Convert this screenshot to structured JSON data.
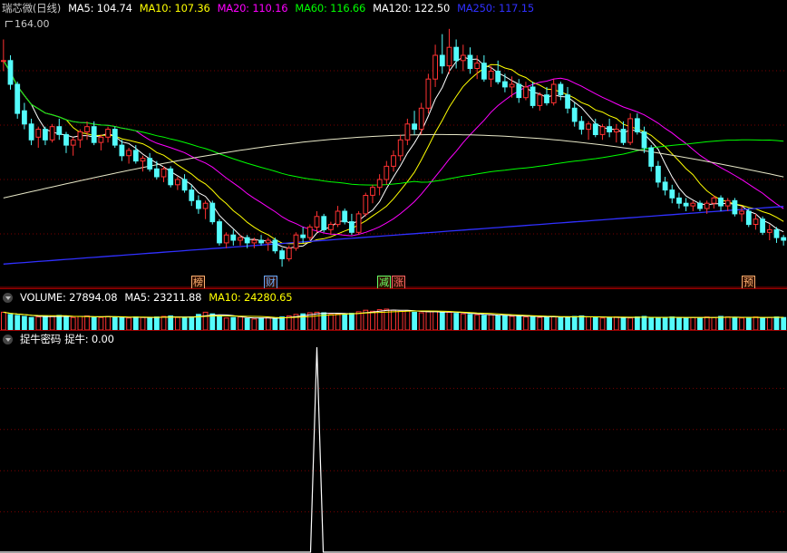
{
  "main": {
    "title": "瑞芯微(日线)",
    "ma_items": [
      {
        "label": "MA5: 104.74",
        "color": "#ffffff"
      },
      {
        "label": "MA10: 107.36",
        "color": "#ffff00"
      },
      {
        "label": "MA20: 110.16",
        "color": "#ff00ff"
      },
      {
        "label": "MA60: 116.66",
        "color": "#00ff00"
      },
      {
        "label": "MA120: 122.50",
        "color": "#ffffff"
      },
      {
        "label": "MA250: 117.15",
        "color": "#3030ff"
      }
    ],
    "high_label": "164.00"
  },
  "markers": [
    {
      "text": "榜",
      "color": "#ffb070"
    },
    {
      "text": "财",
      "color": "#66aaff"
    },
    {
      "text": "减",
      "color": "#66ff66"
    },
    {
      "text": "涨",
      "color": "#ff6666"
    },
    {
      "text": "预",
      "color": "#ffb070"
    }
  ],
  "volume": {
    "label": "VOLUME: 27894.08",
    "ma5": "MA5: 23211.88",
    "ma10": "MA10: 24280.65"
  },
  "indicator": {
    "name": "捉牛密码",
    "value_label": "捉牛: 0.00"
  },
  "colors": {
    "up": "#ff3232",
    "down": "#54fcfc",
    "grid": "#7a0000"
  },
  "chart_data": {
    "type": "candlestick",
    "price_high_label": 164.0,
    "candles": [
      [
        150,
        158,
        146,
        150
      ],
      [
        150,
        152,
        139,
        141
      ],
      [
        141,
        142,
        128,
        130
      ],
      [
        131,
        134,
        124,
        126
      ],
      [
        126,
        128,
        118,
        120
      ],
      [
        121,
        125,
        117,
        124
      ],
      [
        124,
        125,
        118,
        120
      ],
      [
        120,
        126,
        119,
        125
      ],
      [
        125,
        128,
        120,
        122
      ],
      [
        122,
        123,
        115,
        118
      ],
      [
        118,
        121,
        114,
        120
      ],
      [
        120,
        124,
        117,
        123
      ],
      [
        123,
        127,
        120,
        125
      ],
      [
        125,
        127,
        118,
        119
      ],
      [
        119,
        122,
        116,
        121
      ],
      [
        121,
        125,
        119,
        124
      ],
      [
        124,
        125,
        117,
        118
      ],
      [
        118,
        120,
        112,
        114
      ],
      [
        114,
        117,
        111,
        116
      ],
      [
        116,
        118,
        111,
        112
      ],
      [
        112,
        114,
        108,
        113
      ],
      [
        113,
        115,
        108,
        109
      ],
      [
        109,
        112,
        105,
        106
      ],
      [
        106,
        110,
        104,
        109
      ],
      [
        109,
        110,
        102,
        103
      ],
      [
        103,
        106,
        101,
        105
      ],
      [
        105,
        107,
        100,
        101
      ],
      [
        101,
        103,
        95,
        97
      ],
      [
        97,
        99,
        92,
        94
      ],
      [
        94,
        97,
        90,
        96
      ],
      [
        96,
        97,
        88,
        89
      ],
      [
        89,
        90,
        80,
        81
      ],
      [
        81,
        85,
        79,
        84
      ],
      [
        84,
        86,
        80,
        82
      ],
      [
        82,
        84,
        80,
        83
      ],
      [
        83,
        84,
        79,
        81
      ],
      [
        81,
        83,
        79,
        82
      ],
      [
        82,
        84,
        80,
        81
      ],
      [
        81,
        83,
        78,
        82
      ],
      [
        82,
        83,
        77,
        78
      ],
      [
        78,
        79,
        72,
        75
      ],
      [
        75,
        80,
        74,
        79
      ],
      [
        79,
        85,
        78,
        84
      ],
      [
        84,
        87,
        81,
        83
      ],
      [
        83,
        88,
        82,
        87
      ],
      [
        87,
        93,
        85,
        91
      ],
      [
        91,
        92,
        85,
        86
      ],
      [
        86,
        89,
        84,
        88
      ],
      [
        88,
        95,
        87,
        93
      ],
      [
        93,
        94,
        88,
        89
      ],
      [
        89,
        92,
        84,
        85
      ],
      [
        85,
        93,
        84,
        92
      ],
      [
        92,
        100,
        91,
        99
      ],
      [
        99,
        103,
        96,
        102
      ],
      [
        102,
        107,
        99,
        105
      ],
      [
        105,
        112,
        103,
        110
      ],
      [
        110,
        116,
        108,
        114
      ],
      [
        114,
        122,
        112,
        120
      ],
      [
        120,
        128,
        118,
        126
      ],
      [
        126,
        131,
        122,
        124
      ],
      [
        124,
        134,
        122,
        132
      ],
      [
        132,
        145,
        130,
        143
      ],
      [
        143,
        156,
        140,
        152
      ],
      [
        152,
        160,
        145,
        148
      ],
      [
        148,
        162,
        145,
        155
      ],
      [
        155,
        158,
        147,
        150
      ],
      [
        150,
        156,
        146,
        152
      ],
      [
        152,
        155,
        145,
        147
      ],
      [
        147,
        152,
        143,
        149
      ],
      [
        149,
        152,
        142,
        143
      ],
      [
        143,
        148,
        140,
        146
      ],
      [
        146,
        150,
        141,
        142
      ],
      [
        142,
        145,
        138,
        140
      ],
      [
        140,
        144,
        136,
        141
      ],
      [
        141,
        143,
        134,
        136
      ],
      [
        136,
        142,
        135,
        140
      ],
      [
        140,
        142,
        132,
        133
      ],
      [
        133,
        138,
        131,
        137
      ],
      [
        137,
        140,
        133,
        134
      ],
      [
        134,
        143,
        133,
        141
      ],
      [
        141,
        142,
        135,
        137
      ],
      [
        137,
        140,
        130,
        132
      ],
      [
        132,
        134,
        125,
        127
      ],
      [
        127,
        129,
        122,
        124
      ],
      [
        124,
        127,
        120,
        126
      ],
      [
        126,
        128,
        121,
        122
      ],
      [
        122,
        126,
        120,
        125
      ],
      [
        125,
        128,
        121,
        123
      ],
      [
        123,
        126,
        119,
        124
      ],
      [
        124,
        127,
        118,
        119
      ],
      [
        119,
        130,
        118,
        128
      ],
      [
        128,
        130,
        122,
        123
      ],
      [
        123,
        125,
        115,
        117
      ],
      [
        117,
        118,
        108,
        110
      ],
      [
        110,
        112,
        102,
        104
      ],
      [
        104,
        106,
        99,
        101
      ],
      [
        101,
        103,
        96,
        98
      ],
      [
        98,
        100,
        94,
        96
      ],
      [
        96,
        98,
        93,
        95
      ],
      [
        95,
        97,
        93,
        96
      ],
      [
        96,
        97,
        93,
        94
      ],
      [
        94,
        97,
        92,
        96
      ],
      [
        96,
        99,
        94,
        98
      ],
      [
        98,
        99,
        93,
        95
      ],
      [
        95,
        98,
        93,
        97
      ],
      [
        97,
        98,
        91,
        92
      ],
      [
        92,
        95,
        89,
        93
      ],
      [
        93,
        94,
        87,
        88
      ],
      [
        88,
        92,
        86,
        90
      ],
      [
        90,
        91,
        84,
        85
      ],
      [
        85,
        88,
        82,
        86
      ],
      [
        86,
        87,
        81,
        83
      ],
      [
        83,
        84,
        80,
        82
      ]
    ],
    "volume": [
      34,
      30,
      28,
      26,
      24,
      25,
      26,
      27,
      28,
      25,
      24,
      26,
      27,
      25,
      24,
      26,
      25,
      24,
      23,
      25,
      24,
      23,
      25,
      26,
      27,
      24,
      23,
      25,
      30,
      34,
      31,
      26,
      23,
      24,
      25,
      22,
      21,
      23,
      24,
      22,
      25,
      27,
      30,
      31,
      33,
      34,
      33,
      30,
      31,
      30,
      32,
      35,
      38,
      36,
      39,
      40,
      38,
      36,
      37,
      34,
      33,
      35,
      36,
      33,
      34,
      32,
      31,
      30,
      29,
      28,
      29,
      27,
      28,
      26,
      27,
      25,
      26,
      24,
      25,
      26,
      24,
      25,
      26,
      27,
      25,
      24,
      23,
      24,
      25,
      24,
      23,
      25,
      26,
      24,
      23,
      24,
      25,
      24,
      23,
      24,
      23,
      25,
      24,
      26,
      25,
      24,
      23,
      24,
      25,
      23,
      24,
      25,
      24
    ],
    "indicator_spike_index": 45,
    "indicator_value": 0.0
  }
}
